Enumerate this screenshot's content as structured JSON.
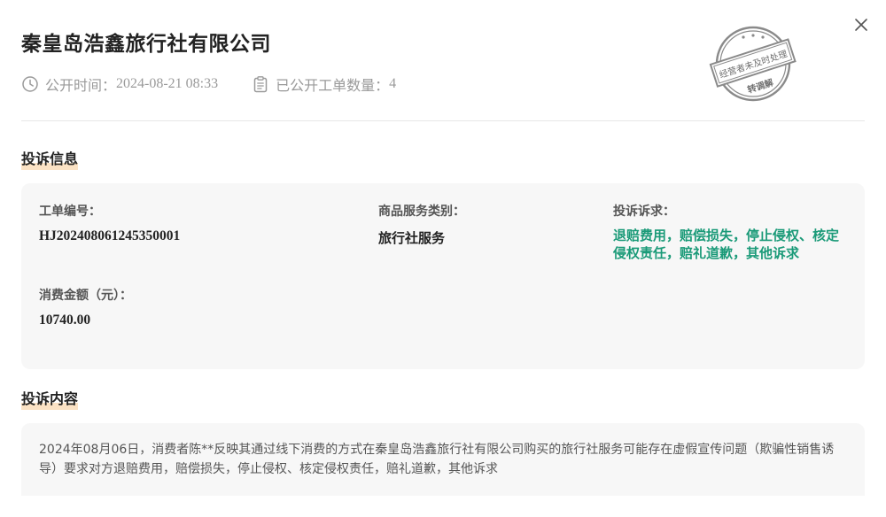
{
  "header": {
    "title": "秦皇岛浩鑫旅行社有限公司",
    "publish_label": "公开时间：",
    "publish_time": "2024-08-21 08:33",
    "count_label": "已公开工单数量：",
    "count_value": "4"
  },
  "stamp": {
    "text": "经营者未及时处理",
    "sub": "转调解",
    "color": "#8a8a8a"
  },
  "info": {
    "section_title": "投诉信息",
    "order_no_label": "工单编号：",
    "order_no": "HJ202408061245350001",
    "category_label": "商品服务类别：",
    "category": "旅行社服务",
    "demand_label": "投诉诉求：",
    "demand": "退赔费用，赔偿损失，停止侵权、核定侵权责任，赔礼道歉，其他诉求",
    "amount_label": "消费金额（元）：",
    "amount": "10740.00"
  },
  "content": {
    "section_title": "投诉内容",
    "text": "2024年08月06日，消费者陈**反映其通过线下消费的方式在秦皇岛浩鑫旅行社有限公司购买的旅行社服务可能存在虚假宣传问题（欺骗性销售诱导）要求对方退赔费用，赔偿损失，停止侵权、核定侵权责任，赔礼道歉，其他诉求"
  },
  "colors": {
    "accent_green": "#1a9a78",
    "highlight": "#fbe2c4",
    "card_bg": "#f7f7f7"
  },
  "icons": {
    "close": "close-icon",
    "clock": "clock-icon",
    "clipboard": "clipboard-icon"
  }
}
